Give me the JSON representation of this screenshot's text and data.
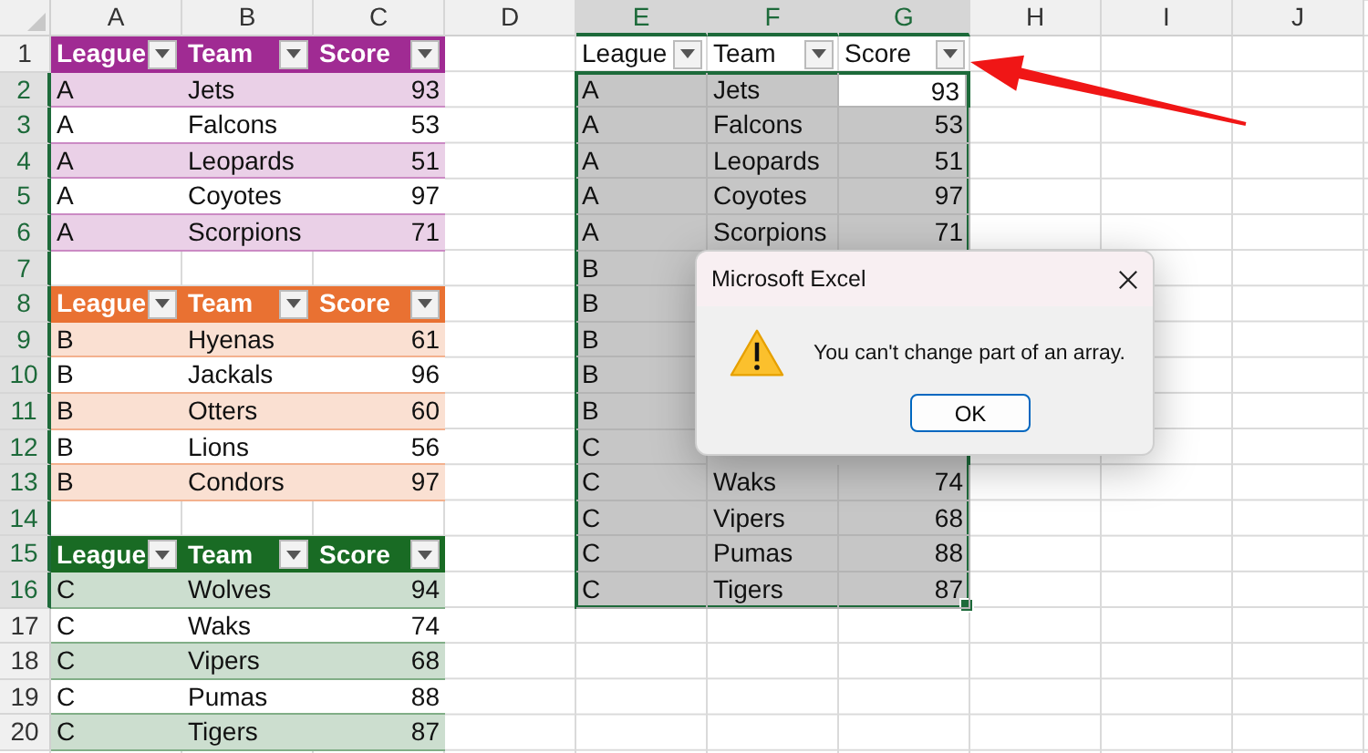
{
  "column_headers": [
    {
      "label": "A",
      "selected": false
    },
    {
      "label": "B",
      "selected": false
    },
    {
      "label": "C",
      "selected": false
    },
    {
      "label": "D",
      "selected": false
    },
    {
      "label": "E",
      "selected": true
    },
    {
      "label": "F",
      "selected": true
    },
    {
      "label": "G",
      "selected": true
    },
    {
      "label": "H",
      "selected": false
    },
    {
      "label": "I",
      "selected": false
    },
    {
      "label": "J",
      "selected": false
    }
  ],
  "row_numbers": [
    {
      "label": "1",
      "selected": false
    },
    {
      "label": "2",
      "selected": true
    },
    {
      "label": "3",
      "selected": true
    },
    {
      "label": "4",
      "selected": true
    },
    {
      "label": "5",
      "selected": true
    },
    {
      "label": "6",
      "selected": true
    },
    {
      "label": "7",
      "selected": true
    },
    {
      "label": "8",
      "selected": true
    },
    {
      "label": "9",
      "selected": true
    },
    {
      "label": "10",
      "selected": true
    },
    {
      "label": "11",
      "selected": true
    },
    {
      "label": "12",
      "selected": true
    },
    {
      "label": "13",
      "selected": true
    },
    {
      "label": "14",
      "selected": true
    },
    {
      "label": "15",
      "selected": true
    },
    {
      "label": "16",
      "selected": true
    },
    {
      "label": "17",
      "selected": false
    },
    {
      "label": "18",
      "selected": false
    },
    {
      "label": "19",
      "selected": false
    },
    {
      "label": "20",
      "selected": false
    }
  ],
  "tables": [
    {
      "color": "#a02b93",
      "columns": [
        "League",
        "Team",
        "Score"
      ],
      "rows": [
        [
          "A",
          "Jets",
          "93"
        ],
        [
          "A",
          "Falcons",
          "53"
        ],
        [
          "A",
          "Leopards",
          "51"
        ],
        [
          "A",
          "Coyotes",
          "97"
        ],
        [
          "A",
          "Scorpions",
          "71"
        ]
      ]
    },
    {
      "color": "#e97132",
      "columns": [
        "League",
        "Team",
        "Score"
      ],
      "rows": [
        [
          "B",
          "Hyenas",
          "61"
        ],
        [
          "B",
          "Jackals",
          "96"
        ],
        [
          "B",
          "Otters",
          "60"
        ],
        [
          "B",
          "Lions",
          "56"
        ],
        [
          "B",
          "Condors",
          "97"
        ]
      ]
    },
    {
      "color": "#196b24",
      "columns": [
        "League",
        "Team",
        "Score"
      ],
      "rows": [
        [
          "C",
          "Wolves",
          "94"
        ],
        [
          "C",
          "Waks",
          "74"
        ],
        [
          "C",
          "Vipers",
          "68"
        ],
        [
          "C",
          "Pumas",
          "88"
        ],
        [
          "C",
          "Tigers",
          "87"
        ]
      ]
    }
  ],
  "spill": {
    "columns": [
      "League",
      "Team",
      "Score"
    ],
    "rows": [
      {
        "league": "A",
        "team": "Jets",
        "score": "93",
        "active": true
      },
      {
        "league": "A",
        "team": "Falcons",
        "score": "53",
        "active": false
      },
      {
        "league": "A",
        "team": "Leopards",
        "score": "51",
        "active": false
      },
      {
        "league": "A",
        "team": "Coyotes",
        "score": "97",
        "active": false
      },
      {
        "league": "A",
        "team": "Scorpions",
        "score": "71",
        "active": false
      },
      {
        "league": "B"
      },
      {
        "league": "B"
      },
      {
        "league": "B"
      },
      {
        "league": "B"
      },
      {
        "league": "B"
      },
      {
        "league": "C"
      },
      {
        "league": "C",
        "team": "Waks",
        "score": "74",
        "active": false
      },
      {
        "league": "C",
        "team": "Vipers",
        "score": "68",
        "active": false
      },
      {
        "league": "C",
        "team": "Pumas",
        "score": "88",
        "active": false
      },
      {
        "league": "C",
        "team": "Tigers",
        "score": "87",
        "active": false
      }
    ]
  },
  "dialog": {
    "title": "Microsoft Excel",
    "message": "You can't change part of an array.",
    "button": "OK"
  }
}
